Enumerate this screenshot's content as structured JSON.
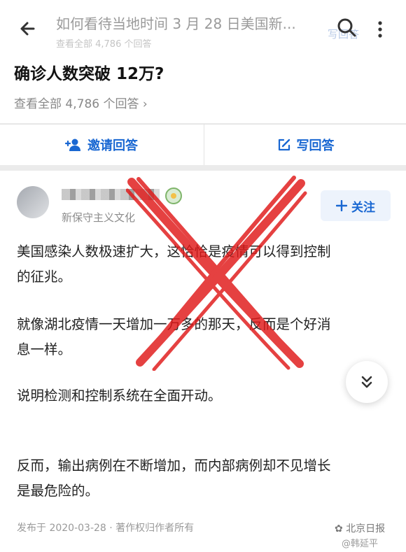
{
  "header": {
    "title": "如何看待当地时间 3 月 28 日美国新...",
    "subtitle": "查看全部 4,786 个回答",
    "ghost_label": "写回答"
  },
  "question": {
    "title": "确诊人数突破 12万?",
    "answers_count": "查看全部 4,786 个回答 ›"
  },
  "actions": {
    "invite": "邀请回答",
    "write": "写回答"
  },
  "answer": {
    "author_description": "新保守主义文化",
    "follow_label": "关注",
    "paragraphs": [
      "美国感染人数极速扩大，这恰恰是疫情可以得到控制\n的征兆。",
      "就像湖北疫情一天增加一万多的那天，反而是个好消\n息一样。",
      "说明检测和控制系统在全面开动。",
      "反而，输出病例在不断增加，而内部病例却不见增长\n是最危险的。"
    ],
    "footer": "发布于 2020-03-28 · 著作权归作者所有"
  },
  "watermark": {
    "line1": "北京日报",
    "line2": "@韩延平"
  },
  "colors": {
    "accent": "#1967d2",
    "overlay_x": "#e01818"
  }
}
